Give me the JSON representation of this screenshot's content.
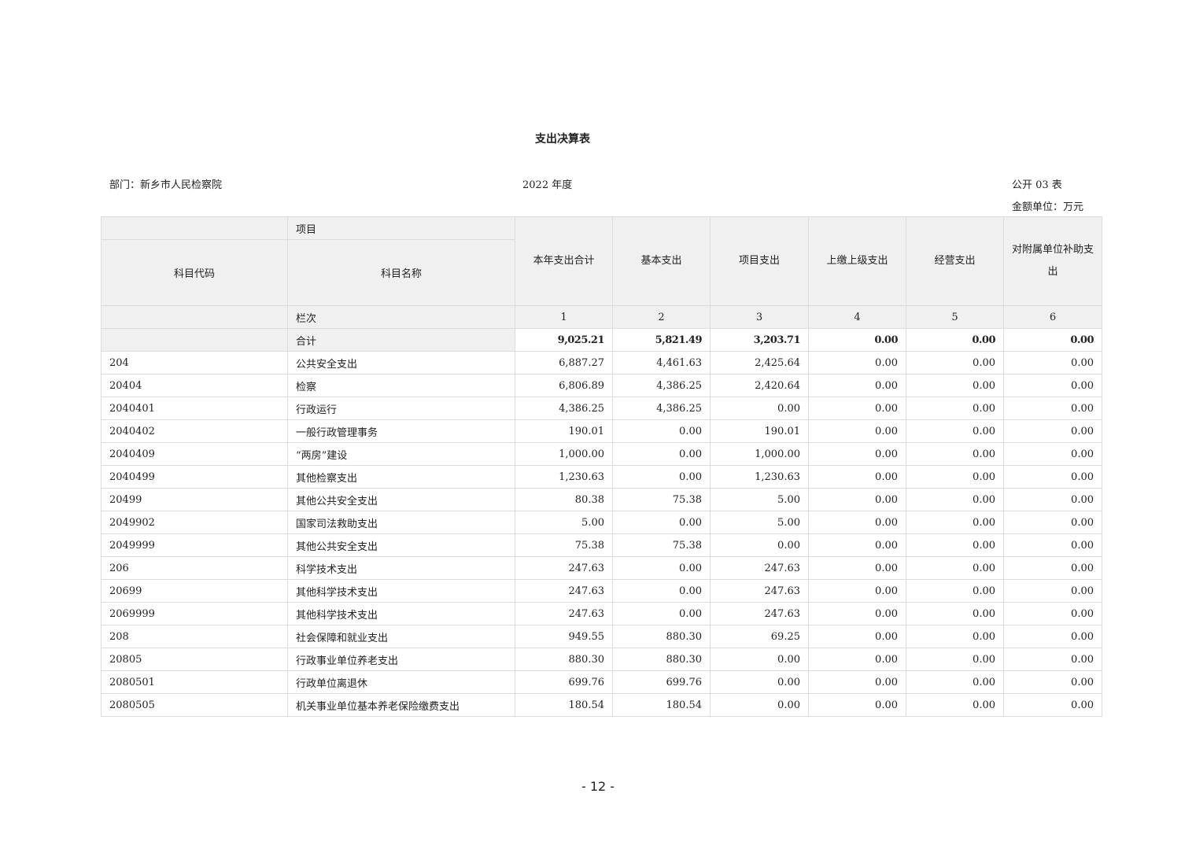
{
  "title": "支出决算表",
  "department": "部门：新乡市人民检察院",
  "year": "2022 年度",
  "form_code": "公开 03 表",
  "unit": "金额单位：万元",
  "header": {
    "item": "项目",
    "code": "科目代码",
    "name": "科目名称",
    "columns": [
      "本年支出合计",
      "基本支出",
      "项目支出",
      "上缴上级支出",
      "经营支出",
      "对附属单位补助支出"
    ],
    "column_numbers_label": "栏次",
    "column_numbers": [
      "1",
      "2",
      "3",
      "4",
      "5",
      "6"
    ]
  },
  "total": {
    "label": "合计",
    "values": [
      "9,025.21",
      "5,821.49",
      "3,203.71",
      "0.00",
      "0.00",
      "0.00"
    ]
  },
  "rows": [
    {
      "code": "204",
      "name": "公共安全支出",
      "values": [
        "6,887.27",
        "4,461.63",
        "2,425.64",
        "0.00",
        "0.00",
        "0.00"
      ]
    },
    {
      "code": "20404",
      "name": "检察",
      "values": [
        "6,806.89",
        "4,386.25",
        "2,420.64",
        "0.00",
        "0.00",
        "0.00"
      ]
    },
    {
      "code": "2040401",
      "name": "行政运行",
      "values": [
        "4,386.25",
        "4,386.25",
        "0.00",
        "0.00",
        "0.00",
        "0.00"
      ]
    },
    {
      "code": "2040402",
      "name": "一般行政管理事务",
      "values": [
        "190.01",
        "0.00",
        "190.01",
        "0.00",
        "0.00",
        "0.00"
      ]
    },
    {
      "code": "2040409",
      "name": "“两房”建设",
      "values": [
        "1,000.00",
        "0.00",
        "1,000.00",
        "0.00",
        "0.00",
        "0.00"
      ]
    },
    {
      "code": "2040499",
      "name": "其他检察支出",
      "values": [
        "1,230.63",
        "0.00",
        "1,230.63",
        "0.00",
        "0.00",
        "0.00"
      ]
    },
    {
      "code": "20499",
      "name": "其他公共安全支出",
      "values": [
        "80.38",
        "75.38",
        "5.00",
        "0.00",
        "0.00",
        "0.00"
      ]
    },
    {
      "code": "2049902",
      "name": "国家司法救助支出",
      "values": [
        "5.00",
        "0.00",
        "5.00",
        "0.00",
        "0.00",
        "0.00"
      ]
    },
    {
      "code": "2049999",
      "name": "其他公共安全支出",
      "values": [
        "75.38",
        "75.38",
        "0.00",
        "0.00",
        "0.00",
        "0.00"
      ]
    },
    {
      "code": "206",
      "name": "科学技术支出",
      "values": [
        "247.63",
        "0.00",
        "247.63",
        "0.00",
        "0.00",
        "0.00"
      ]
    },
    {
      "code": "20699",
      "name": "其他科学技术支出",
      "values": [
        "247.63",
        "0.00",
        "247.63",
        "0.00",
        "0.00",
        "0.00"
      ]
    },
    {
      "code": "2069999",
      "name": "其他科学技术支出",
      "values": [
        "247.63",
        "0.00",
        "247.63",
        "0.00",
        "0.00",
        "0.00"
      ]
    },
    {
      "code": "208",
      "name": "社会保障和就业支出",
      "values": [
        "949.55",
        "880.30",
        "69.25",
        "0.00",
        "0.00",
        "0.00"
      ]
    },
    {
      "code": "20805",
      "name": "行政事业单位养老支出",
      "values": [
        "880.30",
        "880.30",
        "0.00",
        "0.00",
        "0.00",
        "0.00"
      ]
    },
    {
      "code": "2080501",
      "name": "行政单位离退休",
      "values": [
        "699.76",
        "699.76",
        "0.00",
        "0.00",
        "0.00",
        "0.00"
      ]
    },
    {
      "code": "2080505",
      "name": "机关事业单位基本养老保险缴费支出",
      "values": [
        "180.54",
        "180.54",
        "0.00",
        "0.00",
        "0.00",
        "0.00"
      ]
    }
  ],
  "page_number": "- 12 -"
}
